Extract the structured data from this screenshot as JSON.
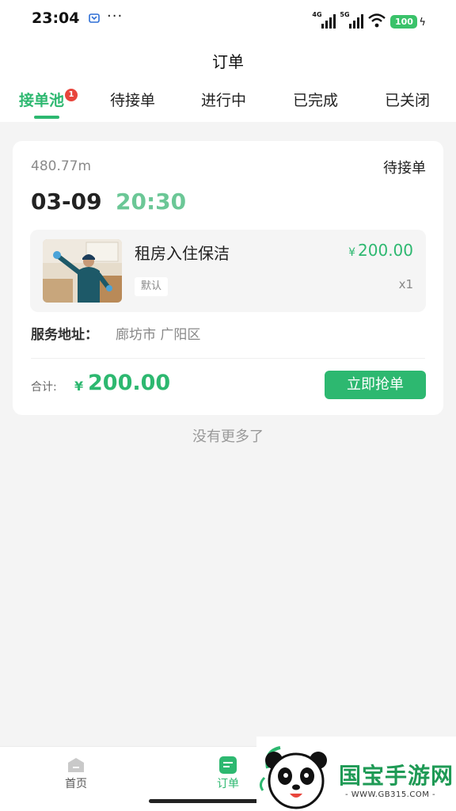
{
  "status_bar": {
    "time": "23:04",
    "app_icon": "app-notification-icon",
    "dots": "···",
    "signal1_tag": "4G",
    "signal2_tag": "5G",
    "battery": "100"
  },
  "header": {
    "title": "订单"
  },
  "tabs": [
    {
      "label": "接单池",
      "badge": "1",
      "active": true
    },
    {
      "label": "待接单"
    },
    {
      "label": "进行中"
    },
    {
      "label": "已完成"
    },
    {
      "label": "已关闭"
    }
  ],
  "order": {
    "distance": "480.77m",
    "status": "待接单",
    "date": "03-09",
    "time": "20:30",
    "item": {
      "name": "租房入住保洁",
      "currency": "¥",
      "price": "200.00",
      "spec": "默认",
      "quantity": "x1"
    },
    "address_label": "服务地址：",
    "address_value": "廊坊市 广阳区",
    "total_label": "合计:",
    "total_currency": "¥",
    "total_value": "200.00",
    "grab_button": "立即抢单"
  },
  "list_footer": "没有更多了",
  "bottom_nav": [
    {
      "label": "首页",
      "icon": "home-icon"
    },
    {
      "label": "订单",
      "icon": "order-icon",
      "active": true
    }
  ],
  "watermark": {
    "text": "国宝手游网",
    "url": "- WWW.GB315.COM -"
  },
  "colors": {
    "accent": "#2db870",
    "time_green": "#6bc796",
    "badge_red": "#e8453c"
  }
}
